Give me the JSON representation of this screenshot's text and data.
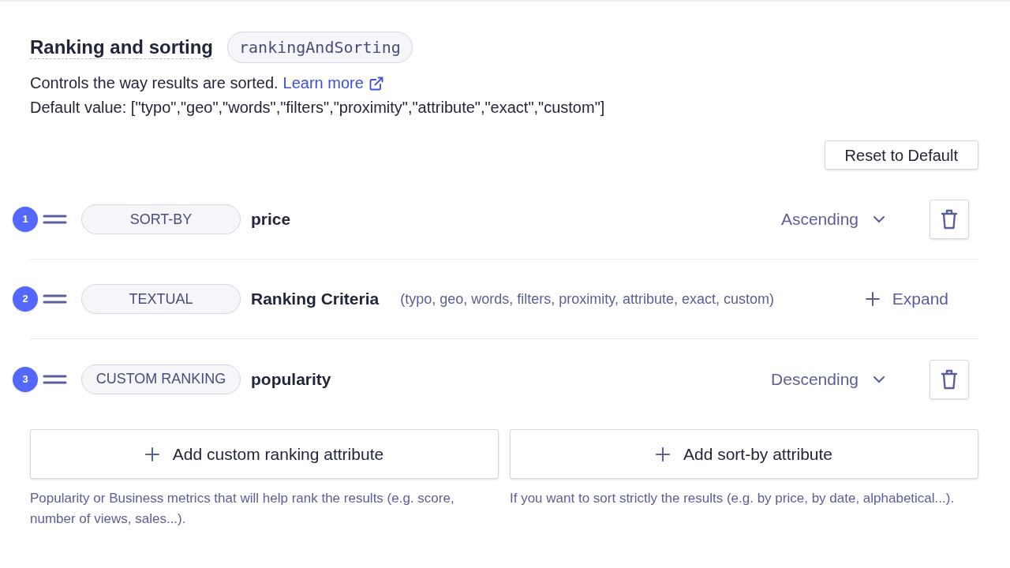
{
  "header": {
    "title": "Ranking and sorting",
    "code": "rankingAndSorting",
    "description": "Controls the way results are sorted.",
    "link": "Learn more",
    "default_value": "Default value: [\"typo\",\"geo\",\"words\",\"filters\",\"proximity\",\"attribute\",\"exact\",\"custom\"]"
  },
  "reset_button": "Reset to Default",
  "rows": [
    {
      "kind": "sort",
      "number": "1",
      "tag": "SORT-BY",
      "name": "price",
      "order": "Ascending"
    },
    {
      "kind": "textual",
      "number": "2",
      "tag": "TEXTUAL",
      "name": "Ranking Criteria",
      "criteria": "(typo, geo, words, filters, proximity, attribute, exact, custom)",
      "action": "Expand"
    },
    {
      "kind": "sort",
      "number": "3",
      "tag": "CUSTOM RANKING",
      "name": "popularity",
      "order": "Descending"
    }
  ],
  "add_actions": [
    {
      "label": "Add custom ranking attribute",
      "help": "Popularity or Business metrics that will help rank the results (e.g. score, number of views, sales...)."
    },
    {
      "label": "Add sort-by attribute",
      "help": "If you want to sort strictly the results (e.g. by price, by date, alphabetical...)."
    }
  ]
}
